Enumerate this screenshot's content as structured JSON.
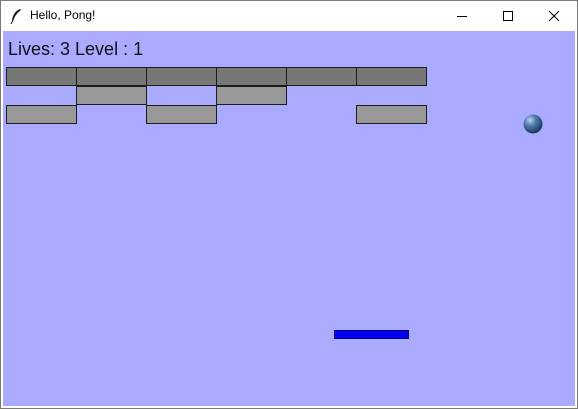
{
  "window": {
    "title": "Hello, Pong!",
    "icons": {
      "app": "feather-icon",
      "minimize": "minimize-icon",
      "maximize": "maximize-icon",
      "close": "close-icon"
    }
  },
  "hud": {
    "text": "Lives: 3 Level : 1"
  },
  "colors": {
    "background": "#aaaaff",
    "brick_dark": "#777777",
    "brick_light": "#999999",
    "paddle": "#0000ee",
    "ball": "#4a7aa8"
  },
  "bricks": {
    "rows": [
      [
        "dark",
        "dark",
        "dark",
        "dark",
        "dark",
        "dark"
      ],
      [
        "empty",
        "light",
        "empty",
        "light",
        "empty",
        "empty"
      ],
      [
        "light",
        "empty",
        "light",
        "empty",
        "empty",
        "light"
      ]
    ]
  }
}
